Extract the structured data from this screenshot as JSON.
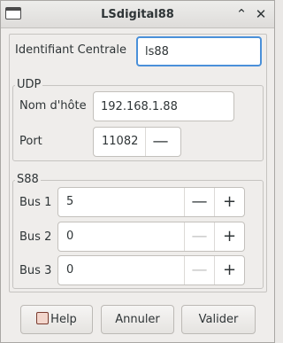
{
  "window": {
    "title": "LSdigital88"
  },
  "central": {
    "label": "Identifiant Centrale",
    "value": "ls88"
  },
  "udp": {
    "title": "UDP",
    "host_label": "Nom d'hôte",
    "host_value": "192.168.1.88",
    "port_label": "Port",
    "port_value": "11082"
  },
  "s88": {
    "title": "S88",
    "buses": [
      {
        "label": "Bus 1",
        "value": "5"
      },
      {
        "label": "Bus 2",
        "value": "0"
      },
      {
        "label": "Bus 3",
        "value": "0"
      }
    ]
  },
  "buttons": {
    "help": "Help",
    "cancel": "Annuler",
    "ok": "Valider"
  },
  "glyphs": {
    "minus": "—",
    "plus": "+",
    "minimize": "⌃",
    "close": "✕"
  },
  "colors": {
    "focus": "#4a90d9",
    "window_bg": "#efedeb"
  }
}
